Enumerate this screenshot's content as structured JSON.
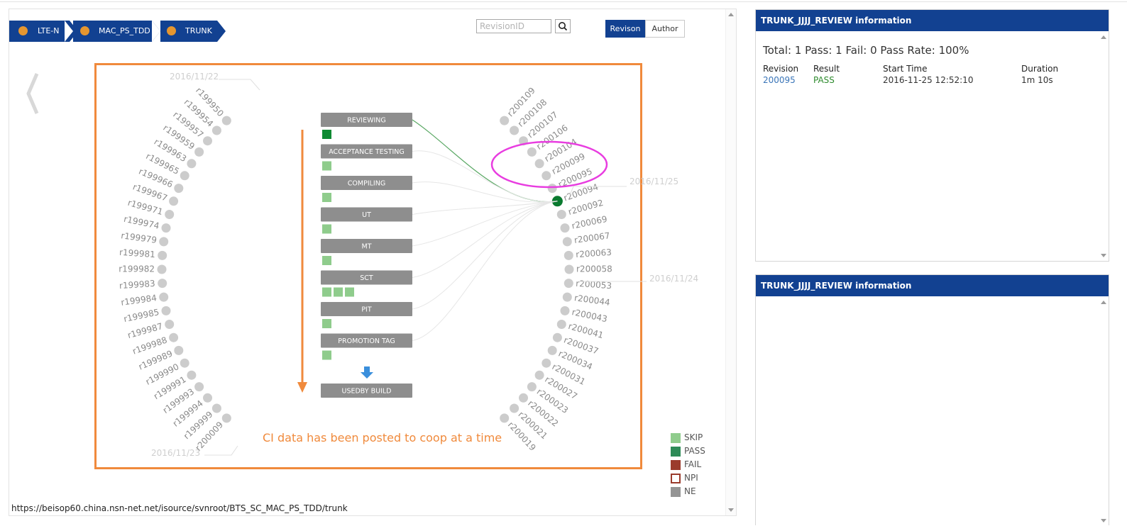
{
  "breadcrumb": [
    "LTE-N",
    "MAC_PS_TDD",
    "TRUNK"
  ],
  "search": {
    "placeholder": "RevisionID"
  },
  "view_toggle": {
    "active": "Revison",
    "inactive": "Author"
  },
  "pipeline": {
    "stages": [
      {
        "label": "REVIEWING",
        "squares": [
          "pass"
        ]
      },
      {
        "label": "ACCEPTANCE TESTING",
        "squares": [
          "skip"
        ]
      },
      {
        "label": "COMPILING",
        "squares": [
          "skip"
        ]
      },
      {
        "label": "UT",
        "squares": [
          "skip"
        ]
      },
      {
        "label": "MT",
        "squares": [
          "skip"
        ]
      },
      {
        "label": "SCT",
        "squares": [
          "skip",
          "skip",
          "skip"
        ]
      },
      {
        "label": "PIT",
        "squares": [
          "skip"
        ]
      },
      {
        "label": "PROMOTION TAG",
        "squares": [
          "skip"
        ]
      }
    ],
    "final_stage": "USEDBY BUILD"
  },
  "revisions_left": [
    "r199950",
    "r199954",
    "r199957",
    "r199959",
    "r199963",
    "r199965",
    "r199966",
    "r199967",
    "r199971",
    "r199974",
    "r199979",
    "r199981",
    "r199982",
    "r199983",
    "r199984",
    "r199985",
    "r199987",
    "r199988",
    "r199989",
    "r199990",
    "r199991",
    "r199993",
    "r199994",
    "r199999",
    "r200009"
  ],
  "revisions_right": [
    "r200109",
    "r200108",
    "r200107",
    "r200106",
    "r200104",
    "r200099",
    "r200095",
    "r200094",
    "r200092",
    "r200069",
    "r200067",
    "r200063",
    "r200058",
    "r200053",
    "r200044",
    "r200043",
    "r200041",
    "r200037",
    "r200034",
    "r200031",
    "r200027",
    "r200023",
    "r200022",
    "r200021",
    "r200019"
  ],
  "selected_revision": "r200094",
  "dates": [
    "2016/11/22",
    "2016/11/25",
    "2016/11/24",
    "2016/11/23"
  ],
  "annotation": "CI data has been posted to coop at a time",
  "legend": [
    {
      "label": "SKIP",
      "color": "#8fcc8c"
    },
    {
      "label": "PASS",
      "color": "#2e8b57"
    },
    {
      "label": "FAIL",
      "color": "#9b3b2c"
    },
    {
      "label": "NPI",
      "color": "#ffffff",
      "border": "#9b3b2c"
    },
    {
      "label": "NE",
      "color": "#949494"
    }
  ],
  "colors": {
    "brand": "#124191",
    "pass_dot": "#0a7a2f",
    "highlight": "#e83de0",
    "annotation": "#f08a3c",
    "revision_dot": "#cccccc"
  },
  "url": "https://beisop60.china.nsn-net.net/isource/svnroot/BTS_SC_MAC_PS_TDD/trunk",
  "info_panel_1": {
    "title": "TRUNK_JJJJ_REVIEW information",
    "summary": "Total: 1 Pass: 1 Fail: 0 Pass Rate: 100%",
    "columns": [
      "Revision",
      "Result",
      "Start Time",
      "Duration"
    ],
    "row": [
      "200095",
      "PASS",
      "2016-11-25 12:52:10",
      "1m 10s"
    ]
  },
  "info_panel_2": {
    "title": "TRUNK_JJJJ_REVIEW information"
  }
}
